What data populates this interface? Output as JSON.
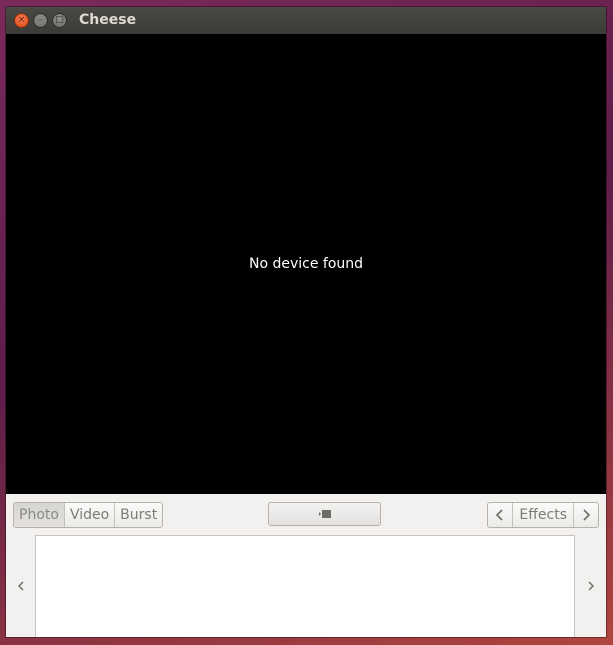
{
  "window": {
    "title": "Cheese",
    "controls": {
      "close_glyph": "×",
      "minimize_glyph": "–",
      "maximize_glyph": "□"
    }
  },
  "viewport": {
    "message": "No device found"
  },
  "toolbar": {
    "modes": [
      {
        "label": "Photo",
        "active": true
      },
      {
        "label": "Video",
        "active": false
      },
      {
        "label": "Burst",
        "active": false
      }
    ],
    "shutter_icon": "camera-icon",
    "effects_label": "Effects"
  },
  "gallery": {
    "prev_icon": "chevron-left-icon",
    "next_icon": "chevron-right-icon"
  },
  "colors": {
    "titlebar": "#3c3b37",
    "close_button": "#df4a16",
    "viewport_bg": "#000000",
    "toolbar_bg": "#f2f1f0"
  }
}
